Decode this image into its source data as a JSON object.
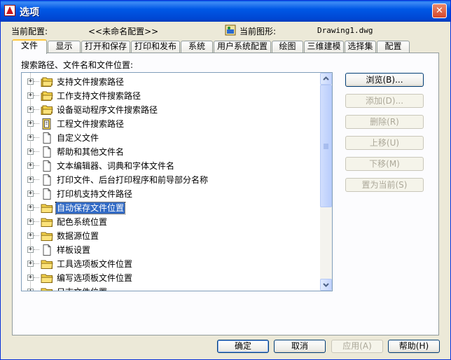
{
  "window": {
    "title": "选项",
    "close_glyph": "✕"
  },
  "config": {
    "current_profile_label": "当前配置:",
    "current_profile_value": "<<未命名配置>>",
    "current_drawing_label": "当前图形:",
    "current_drawing_value": "Drawing1.dwg"
  },
  "tabs": [
    {
      "label": "文件",
      "active": true
    },
    {
      "label": "显示"
    },
    {
      "label": "打开和保存"
    },
    {
      "label": "打印和发布"
    },
    {
      "label": "系统"
    },
    {
      "label": "用户系统配置"
    },
    {
      "label": "绘图"
    },
    {
      "label": "三维建模"
    },
    {
      "label": "选择集"
    },
    {
      "label": "配置"
    }
  ],
  "files_panel": {
    "heading": "搜索路径、文件名和文件位置:",
    "items": [
      {
        "label": "支持文件搜索路径",
        "icon": "folders-icon"
      },
      {
        "label": "工作支持文件搜索路径",
        "icon": "folders-icon"
      },
      {
        "label": "设备驱动程序文件搜索路径",
        "icon": "folders-icon"
      },
      {
        "label": "工程文件搜索路径",
        "icon": "project-icon"
      },
      {
        "label": "自定义文件",
        "icon": "file-icon"
      },
      {
        "label": "帮助和其他文件名",
        "icon": "file-icon"
      },
      {
        "label": "文本编辑器、词典和字体文件名",
        "icon": "file-icon"
      },
      {
        "label": "打印文件、后台打印程序和前导部分名称",
        "icon": "file-icon"
      },
      {
        "label": "打印机支持文件路径",
        "icon": "file-icon"
      },
      {
        "label": "自动保存文件位置",
        "icon": "folder-icon",
        "selected": true
      },
      {
        "label": "配色系统位置",
        "icon": "folder-icon"
      },
      {
        "label": "数据源位置",
        "icon": "folder-icon"
      },
      {
        "label": "样板设置",
        "icon": "file-icon"
      },
      {
        "label": "工具选项板文件位置",
        "icon": "folder-icon"
      },
      {
        "label": "编写选项板文件位置",
        "icon": "folder-icon"
      },
      {
        "label": "日志文件位置",
        "icon": "folder-icon"
      }
    ],
    "expander_glyph": "+"
  },
  "side_buttons": {
    "browse": "浏览(B)...",
    "add": "添加(D)...",
    "remove": "删除(R)",
    "move_up": "上移(U)",
    "move_down": "下移(M)",
    "set_current": "置为当前(S)"
  },
  "footer": {
    "ok": "确定",
    "cancel": "取消",
    "apply": "应用(A)",
    "help": "帮助(H)"
  },
  "colors": {
    "title_bar": "#0054e3",
    "selection": "#316ac5",
    "folder": "#f5d44c"
  }
}
